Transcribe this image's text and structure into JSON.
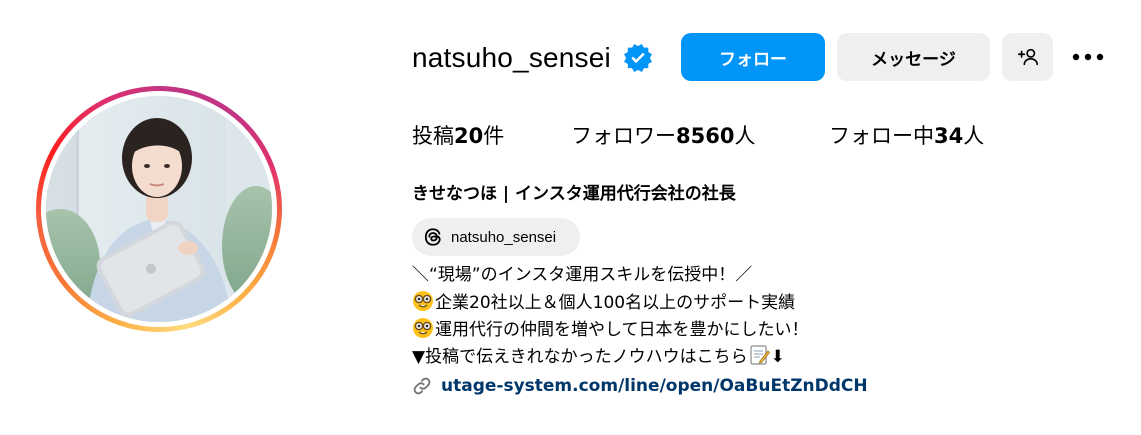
{
  "profile": {
    "username": "natsuho_sensei",
    "verified": true,
    "avatar_alt": "profile photo"
  },
  "actions": {
    "follow_label": "フォロー",
    "message_label": "メッセージ",
    "suggest_icon": "add-person-icon",
    "more_icon": "more-options-icon"
  },
  "stats": {
    "posts_prefix": "投稿",
    "posts_count": "20",
    "posts_suffix": "件",
    "followers_prefix": "フォロワー",
    "followers_count": "8560",
    "followers_suffix": "人",
    "following_prefix": "フォロー中",
    "following_count": "34",
    "following_suffix": "人"
  },
  "bio": {
    "display_name": "きせなつほ | インスタ運用代行会社の社長",
    "threads_handle": "natsuho_sensei",
    "line1": "＼“現場”のインスタ運用スキルを伝授中！／",
    "line2": "企業20社以上＆個人100名以上のサポート実績",
    "line3": "運用代行の仲間を増やして日本を豊かにしたい！",
    "line4": "▼投稿で伝えきれなかったノウハウはこちら",
    "line4_arrow": "⬇",
    "link": "utage-system.com/line/open/OaBuEtZnDdCH"
  },
  "colors": {
    "accent": "#0095f6",
    "secondary_button": "#efefef",
    "link": "#00376b",
    "verified": "#0095f6"
  }
}
